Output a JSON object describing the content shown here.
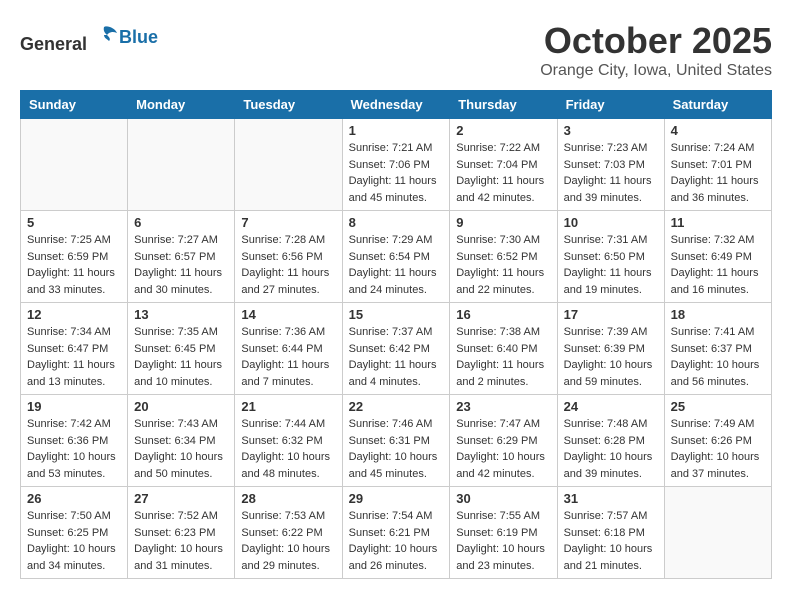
{
  "header": {
    "logo_general": "General",
    "logo_blue": "Blue",
    "month": "October 2025",
    "location": "Orange City, Iowa, United States"
  },
  "weekdays": [
    "Sunday",
    "Monday",
    "Tuesday",
    "Wednesday",
    "Thursday",
    "Friday",
    "Saturday"
  ],
  "weeks": [
    [
      {
        "day": "",
        "info": ""
      },
      {
        "day": "",
        "info": ""
      },
      {
        "day": "",
        "info": ""
      },
      {
        "day": "1",
        "info": "Sunrise: 7:21 AM\nSunset: 7:06 PM\nDaylight: 11 hours\nand 45 minutes."
      },
      {
        "day": "2",
        "info": "Sunrise: 7:22 AM\nSunset: 7:04 PM\nDaylight: 11 hours\nand 42 minutes."
      },
      {
        "day": "3",
        "info": "Sunrise: 7:23 AM\nSunset: 7:03 PM\nDaylight: 11 hours\nand 39 minutes."
      },
      {
        "day": "4",
        "info": "Sunrise: 7:24 AM\nSunset: 7:01 PM\nDaylight: 11 hours\nand 36 minutes."
      }
    ],
    [
      {
        "day": "5",
        "info": "Sunrise: 7:25 AM\nSunset: 6:59 PM\nDaylight: 11 hours\nand 33 minutes."
      },
      {
        "day": "6",
        "info": "Sunrise: 7:27 AM\nSunset: 6:57 PM\nDaylight: 11 hours\nand 30 minutes."
      },
      {
        "day": "7",
        "info": "Sunrise: 7:28 AM\nSunset: 6:56 PM\nDaylight: 11 hours\nand 27 minutes."
      },
      {
        "day": "8",
        "info": "Sunrise: 7:29 AM\nSunset: 6:54 PM\nDaylight: 11 hours\nand 24 minutes."
      },
      {
        "day": "9",
        "info": "Sunrise: 7:30 AM\nSunset: 6:52 PM\nDaylight: 11 hours\nand 22 minutes."
      },
      {
        "day": "10",
        "info": "Sunrise: 7:31 AM\nSunset: 6:50 PM\nDaylight: 11 hours\nand 19 minutes."
      },
      {
        "day": "11",
        "info": "Sunrise: 7:32 AM\nSunset: 6:49 PM\nDaylight: 11 hours\nand 16 minutes."
      }
    ],
    [
      {
        "day": "12",
        "info": "Sunrise: 7:34 AM\nSunset: 6:47 PM\nDaylight: 11 hours\nand 13 minutes."
      },
      {
        "day": "13",
        "info": "Sunrise: 7:35 AM\nSunset: 6:45 PM\nDaylight: 11 hours\nand 10 minutes."
      },
      {
        "day": "14",
        "info": "Sunrise: 7:36 AM\nSunset: 6:44 PM\nDaylight: 11 hours\nand 7 minutes."
      },
      {
        "day": "15",
        "info": "Sunrise: 7:37 AM\nSunset: 6:42 PM\nDaylight: 11 hours\nand 4 minutes."
      },
      {
        "day": "16",
        "info": "Sunrise: 7:38 AM\nSunset: 6:40 PM\nDaylight: 11 hours\nand 2 minutes."
      },
      {
        "day": "17",
        "info": "Sunrise: 7:39 AM\nSunset: 6:39 PM\nDaylight: 10 hours\nand 59 minutes."
      },
      {
        "day": "18",
        "info": "Sunrise: 7:41 AM\nSunset: 6:37 PM\nDaylight: 10 hours\nand 56 minutes."
      }
    ],
    [
      {
        "day": "19",
        "info": "Sunrise: 7:42 AM\nSunset: 6:36 PM\nDaylight: 10 hours\nand 53 minutes."
      },
      {
        "day": "20",
        "info": "Sunrise: 7:43 AM\nSunset: 6:34 PM\nDaylight: 10 hours\nand 50 minutes."
      },
      {
        "day": "21",
        "info": "Sunrise: 7:44 AM\nSunset: 6:32 PM\nDaylight: 10 hours\nand 48 minutes."
      },
      {
        "day": "22",
        "info": "Sunrise: 7:46 AM\nSunset: 6:31 PM\nDaylight: 10 hours\nand 45 minutes."
      },
      {
        "day": "23",
        "info": "Sunrise: 7:47 AM\nSunset: 6:29 PM\nDaylight: 10 hours\nand 42 minutes."
      },
      {
        "day": "24",
        "info": "Sunrise: 7:48 AM\nSunset: 6:28 PM\nDaylight: 10 hours\nand 39 minutes."
      },
      {
        "day": "25",
        "info": "Sunrise: 7:49 AM\nSunset: 6:26 PM\nDaylight: 10 hours\nand 37 minutes."
      }
    ],
    [
      {
        "day": "26",
        "info": "Sunrise: 7:50 AM\nSunset: 6:25 PM\nDaylight: 10 hours\nand 34 minutes."
      },
      {
        "day": "27",
        "info": "Sunrise: 7:52 AM\nSunset: 6:23 PM\nDaylight: 10 hours\nand 31 minutes."
      },
      {
        "day": "28",
        "info": "Sunrise: 7:53 AM\nSunset: 6:22 PM\nDaylight: 10 hours\nand 29 minutes."
      },
      {
        "day": "29",
        "info": "Sunrise: 7:54 AM\nSunset: 6:21 PM\nDaylight: 10 hours\nand 26 minutes."
      },
      {
        "day": "30",
        "info": "Sunrise: 7:55 AM\nSunset: 6:19 PM\nDaylight: 10 hours\nand 23 minutes."
      },
      {
        "day": "31",
        "info": "Sunrise: 7:57 AM\nSunset: 6:18 PM\nDaylight: 10 hours\nand 21 minutes."
      },
      {
        "day": "",
        "info": ""
      }
    ]
  ]
}
